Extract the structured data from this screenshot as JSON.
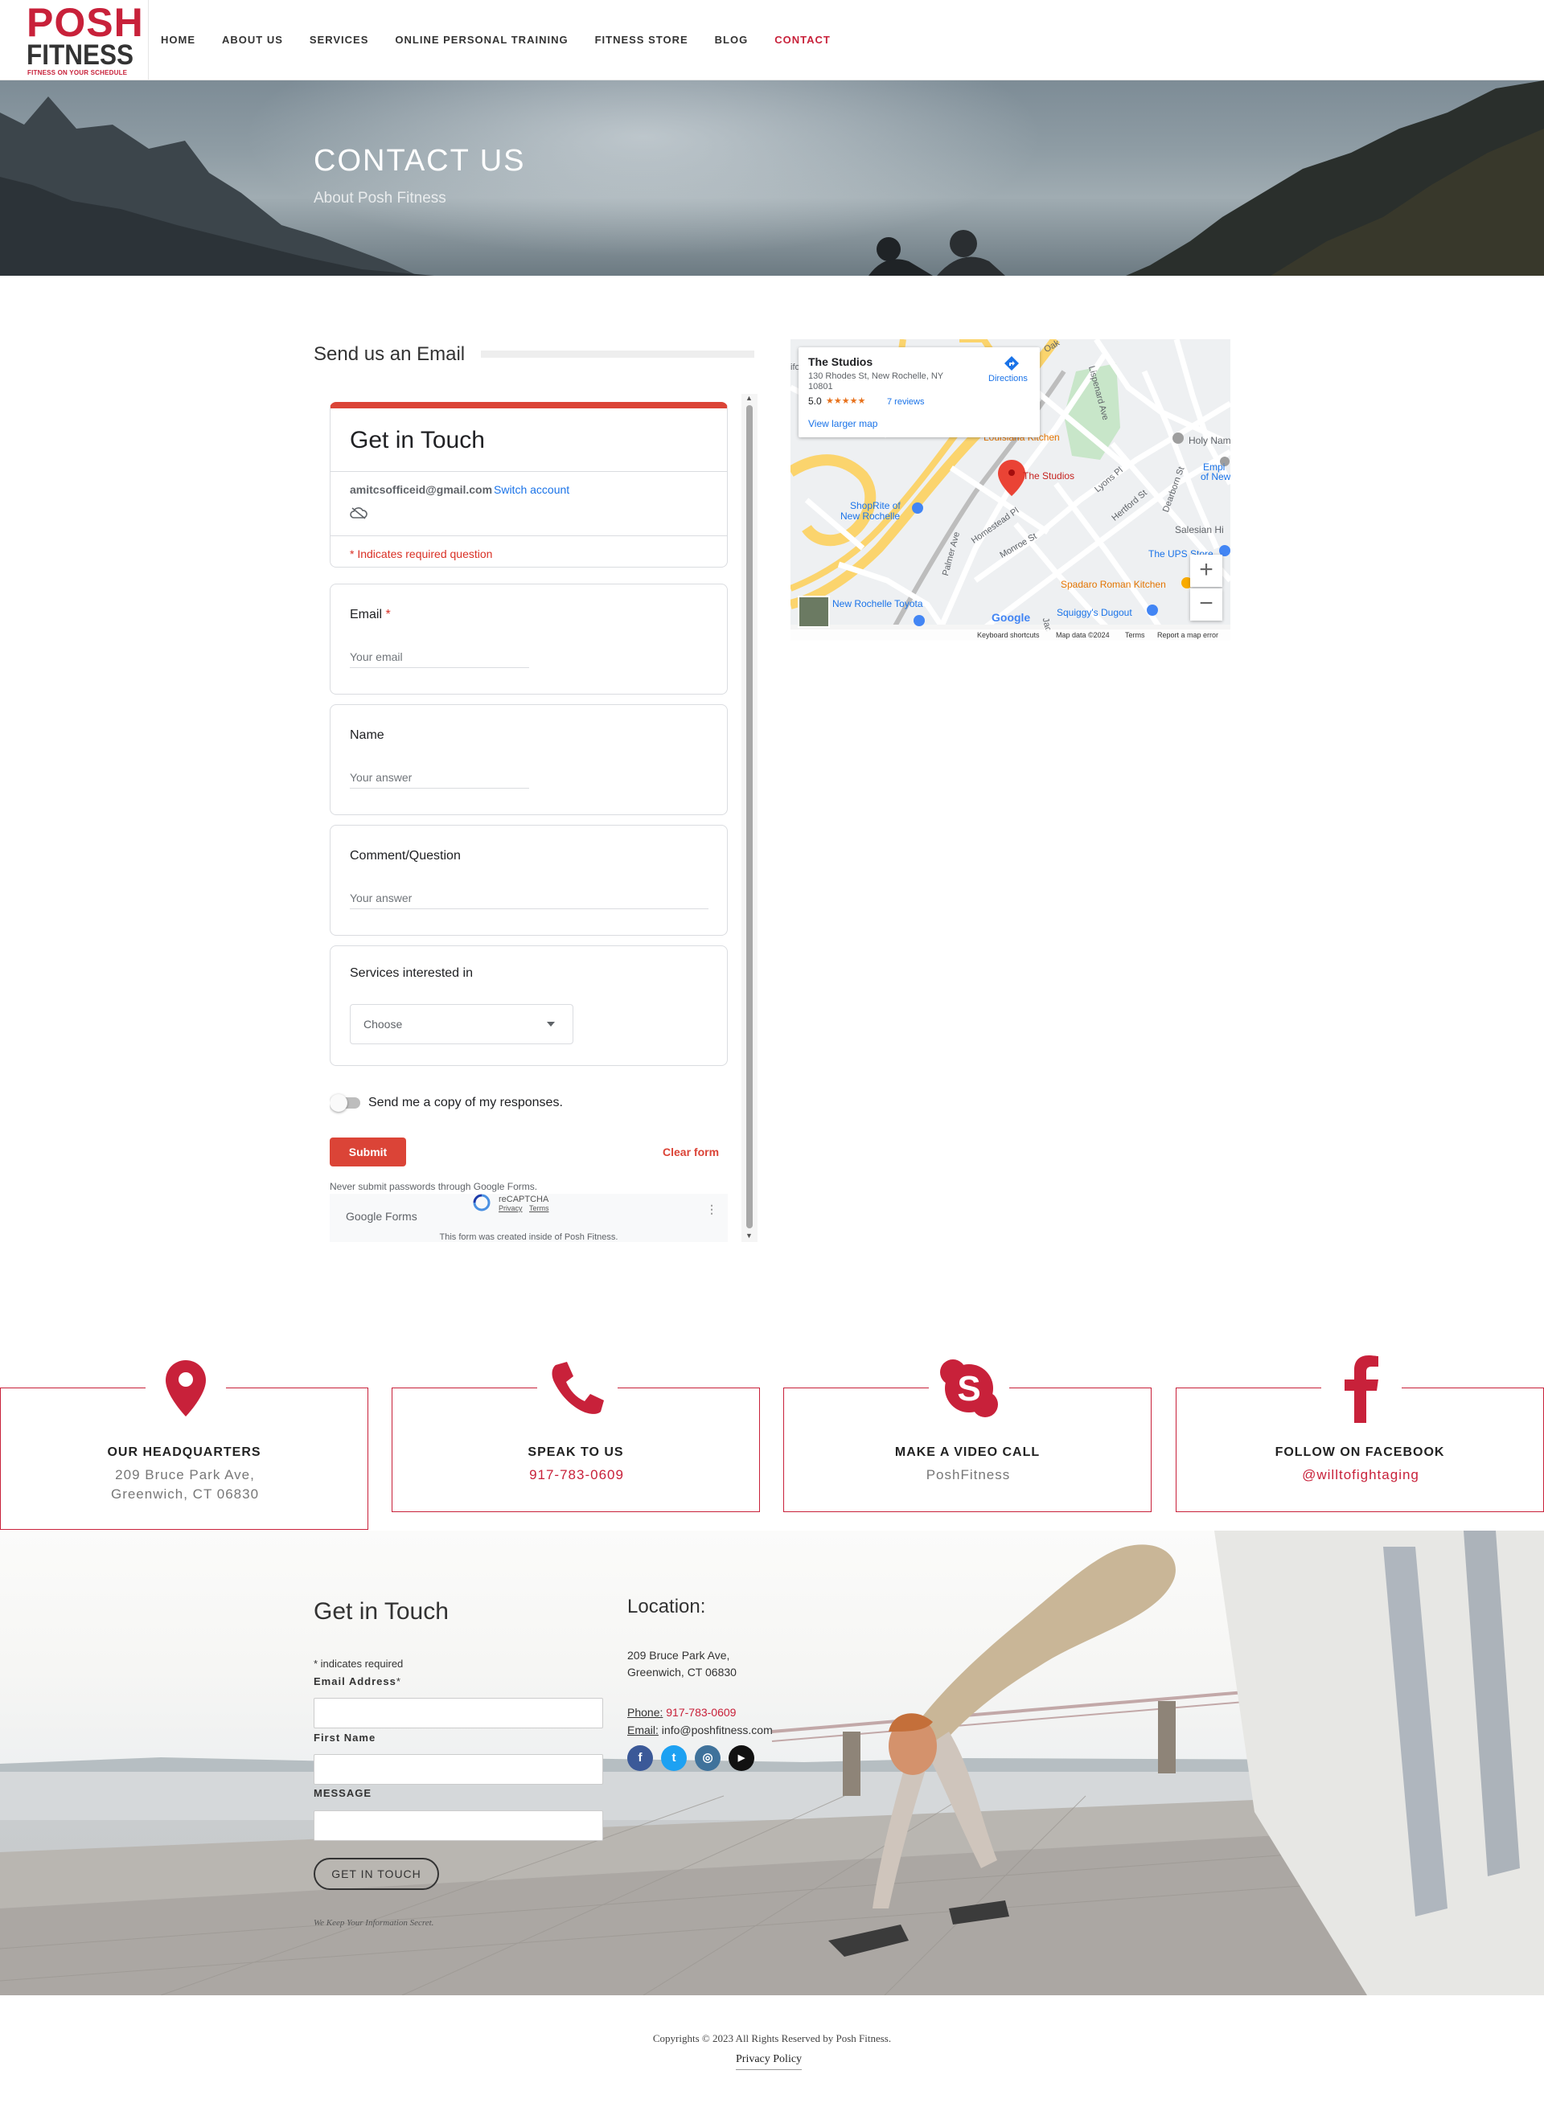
{
  "brand": {
    "logo_line1": "POSH",
    "logo_line2": "FITNESS",
    "tagline": "FITNESS ON YOUR SCHEDULE",
    "primary_color": "#c8213a"
  },
  "nav": {
    "items": [
      "HOME",
      "ABOUT US",
      "SERVICES",
      "ONLINE PERSONAL TRAINING",
      "FITNESS STORE",
      "BLOG",
      "CONTACT"
    ],
    "active": "CONTACT"
  },
  "hero": {
    "title": "CONTACT US",
    "subtitle": "About Posh Fitness"
  },
  "email_section": {
    "title": "Send us an Email"
  },
  "gform": {
    "title": "Get in Touch",
    "account": "amitcsofficeid@gmail.com",
    "switch_account": "Switch account",
    "cloud_icon": "cloud-offline-icon",
    "required_note": "* Indicates required question",
    "questions": {
      "email": {
        "label": "Email",
        "required_mark": "*",
        "placeholder": "Your email"
      },
      "name": {
        "label": "Name",
        "placeholder": "Your answer"
      },
      "comment": {
        "label": "Comment/Question",
        "placeholder": "Your answer"
      },
      "services": {
        "label": "Services interested in",
        "select_value": "Choose"
      }
    },
    "copy_toggle": "Send me a copy of my responses.",
    "submit": "Submit",
    "clear": "Clear form",
    "never_submit": "Never submit passwords through Google Forms.",
    "recaptcha": "reCAPTCHA",
    "recaptcha_privacy": "Privacy",
    "recaptcha_terms": "Terms",
    "google_forms": "Google Forms",
    "created_inside": "This form was created inside of Posh Fitness."
  },
  "map": {
    "place_name": "The Studios",
    "address_line1": "130 Rhodes St, New Rochelle, NY",
    "address_line2": "10801",
    "rating": "5.0",
    "stars": "★★★★★",
    "reviews": "7 reviews",
    "directions": "Directions",
    "larger_map": "View larger map",
    "zoom_in": "+",
    "zoom_out": "−",
    "google": "Google",
    "keyboard": "Keyboard shortcuts",
    "map_data": "Map data ©2024",
    "terms": "Terms",
    "report": "Report a map error",
    "labels": {
      "studios_pin": "The Studios",
      "shoprite1": "ShopRite of",
      "shoprite2": "New Rochelle",
      "toyota": "New Rochelle Toyota",
      "spadaro": "Spadaro Roman Kitchen",
      "squiggy": "Squiggy's Dugout",
      "ups": "The UPS Store",
      "salesian": "Salesian Hi",
      "holy": "Holy Nam",
      "empire1": "Empi",
      "empire2": "of New",
      "louisiana": "Louisiana Kitchen",
      "homestead": "Homestead Pl",
      "monroe": "Monroe St",
      "palmer": "Palmer Ave",
      "lyons": "Lyons Pl",
      "hertford": "Hertford St",
      "dearborn": "Dearborn St",
      "lispenard": "Lispenard Ave",
      "if": "ifo",
      "oak": "Oak",
      "jac": "Jac"
    }
  },
  "contact_boxes": [
    {
      "icon": "map-pin-icon",
      "title": "OUR HEADQUARTERS",
      "line1": "209 Bruce Park Ave,",
      "line2": "Greenwich, CT 06830"
    },
    {
      "icon": "phone-icon",
      "title": "SPEAK TO US",
      "value": "917-783-0609"
    },
    {
      "icon": "skype-icon",
      "title": "MAKE A VIDEO CALL",
      "value": "PoshFitness"
    },
    {
      "icon": "facebook-icon",
      "title": "FOLLOW ON FACEBOOK",
      "value": "@willtofightaging"
    }
  ],
  "footer_form": {
    "title": "Get in Touch",
    "required_note": "* indicates required",
    "email_label": "Email Address",
    "first_name_label": "First Name",
    "message_label": "MESSAGE",
    "button": "GET IN TOUCH",
    "secret": "We Keep Your Information Secret."
  },
  "location": {
    "title": "Location:",
    "addr1": "209 Bruce Park Ave,",
    "addr2": "Greenwich, CT 06830",
    "phone_label": "Phone:",
    "phone": "917-783-0609",
    "email_label": "Email:",
    "email": "info@poshfitness.com",
    "social": [
      {
        "icon": "facebook-icon",
        "glyph": "f",
        "color": "#3b5998"
      },
      {
        "icon": "twitter-icon",
        "glyph": "t",
        "color": "#1da1f2"
      },
      {
        "icon": "instagram-icon",
        "glyph": "◎",
        "color": "#3f729b"
      },
      {
        "icon": "youtube-icon",
        "glyph": "▶",
        "color": "#111111"
      }
    ]
  },
  "footer": {
    "copyright": "Copyrights © 2023 All Rights Reserved by Posh Fitness.",
    "privacy": "Privacy Policy"
  }
}
